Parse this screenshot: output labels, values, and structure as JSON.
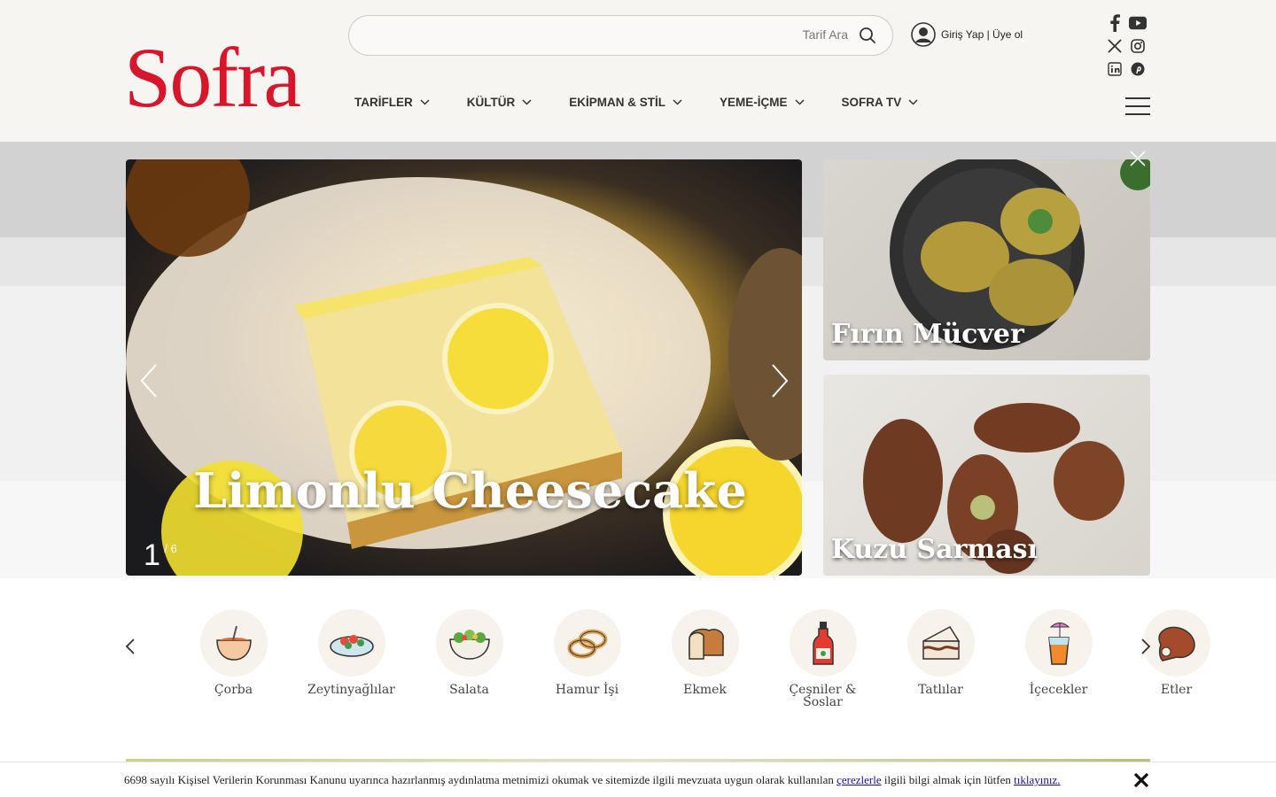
{
  "header": {
    "logo": "Sofra",
    "search_placeholder": "Tarif Ara",
    "login_label": "Giriş Yap | Üye ol"
  },
  "nav": {
    "items": [
      {
        "label": "TARİFLER"
      },
      {
        "label": "KÜLTÜR"
      },
      {
        "label": "EKİPMAN & STİL"
      },
      {
        "label": "YEME-İÇME"
      },
      {
        "label": "SOFRA TV"
      }
    ]
  },
  "hero": {
    "title": "Limonlu Cheesecake",
    "current": "1",
    "total": "/ 6"
  },
  "cards": [
    {
      "title": "Fırın Mücver"
    },
    {
      "title": "Kuzu Sarması"
    }
  ],
  "categories": [
    {
      "label": "Çorba",
      "icon": "soup-bowl-icon"
    },
    {
      "label": "Zeytinyağlılar",
      "icon": "olive-oil-dish-icon"
    },
    {
      "label": "Salata",
      "icon": "salad-bowl-icon"
    },
    {
      "label": "Hamur İşi",
      "icon": "pastry-ring-icon"
    },
    {
      "label": "Ekmek",
      "icon": "bread-icon"
    },
    {
      "label": "Çeşniler & Soslar",
      "icon": "sauce-bottle-icon"
    },
    {
      "label": "Tatlılar",
      "icon": "cake-slice-icon"
    },
    {
      "label": "İçecekler",
      "icon": "drink-cup-icon"
    },
    {
      "label": "Etler",
      "icon": "meat-leg-icon"
    }
  ],
  "cookie": {
    "text_before": "6698 sayılı Kişisel Verilerin Korunması Kanunu uyarınca hazırlanmış aydınlatma metnimizi okumak ve sitemizde ilgili mevzuata uygun olarak kullanılan ",
    "link1": "çerezlerle",
    "text_middle": " ilgili bilgi almak için lütfen ",
    "link2": "tıklayınız."
  },
  "colors": {
    "brand": "#d7152b",
    "header_bg": "#f7f5f2"
  }
}
